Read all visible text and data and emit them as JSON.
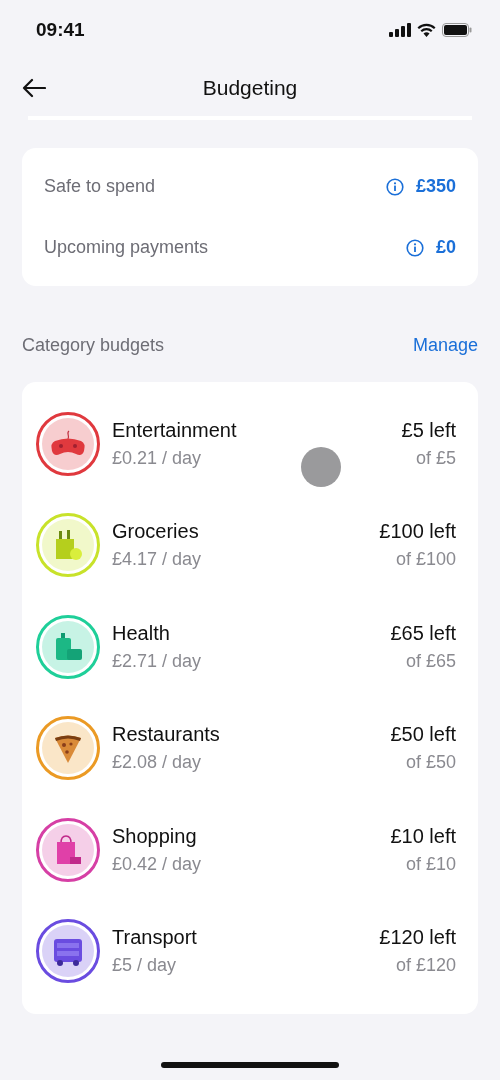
{
  "status_bar": {
    "time": "09:41"
  },
  "nav": {
    "title": "Budgeting"
  },
  "summary": [
    {
      "label": "Safe to spend",
      "value": "£350"
    },
    {
      "label": "Upcoming payments",
      "value": "£0"
    }
  ],
  "section": {
    "title": "Category budgets",
    "action": "Manage"
  },
  "categories": [
    {
      "kind": "gamepad",
      "name": "Entertainment",
      "rate": "£0.21 / day",
      "left": "£5 left",
      "total": "of £5",
      "color": "#e0393e"
    },
    {
      "kind": "groceries",
      "name": "Groceries",
      "rate": "£4.17 / day",
      "left": "£100 left",
      "total": "of £100",
      "color": "#c8e22a"
    },
    {
      "kind": "health",
      "name": "Health",
      "rate": "£2.71 / day",
      "left": "£65 left",
      "total": "of £65",
      "color": "#1fcf99"
    },
    {
      "kind": "pizza",
      "name": "Restaurants",
      "rate": "£2.08 / day",
      "left": "£50 left",
      "total": "of £50",
      "color": "#eb9a24"
    },
    {
      "kind": "bag",
      "name": "Shopping",
      "rate": "£0.42 / day",
      "left": "£10 left",
      "total": "of £10",
      "color": "#d63fa5"
    },
    {
      "kind": "bus",
      "name": "Transport",
      "rate": "£5 / day",
      "left": "£120 left",
      "total": "of £120",
      "color": "#6a4ce0"
    }
  ]
}
